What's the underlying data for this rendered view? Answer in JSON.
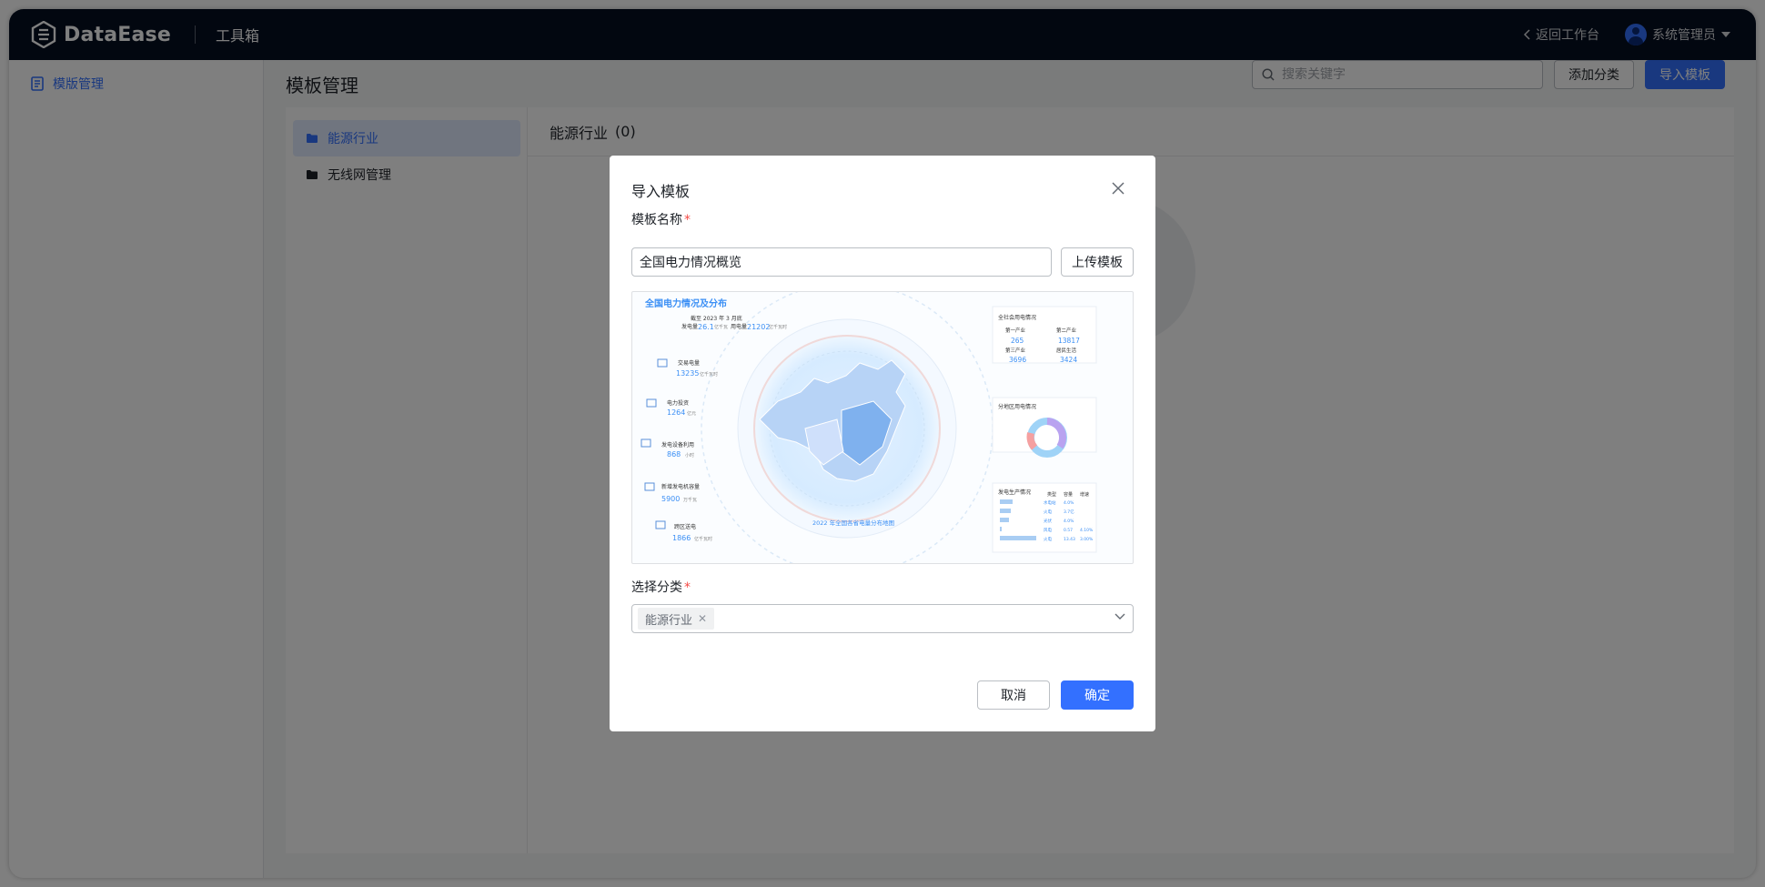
{
  "app": {
    "logo_text": "DataEase",
    "section": "工具箱"
  },
  "header": {
    "back_label": "返回工作台",
    "user_name": "系统管理员"
  },
  "sidebar": {
    "items": [
      {
        "label": "模版管理",
        "icon": "document-icon"
      }
    ]
  },
  "main": {
    "title": "模板管理",
    "search_placeholder": "搜索关键字",
    "add_category_label": "添加分类",
    "import_label": "导入模板",
    "categories": [
      {
        "label": "能源行业",
        "active": true
      },
      {
        "label": "无线网管理",
        "active": false
      }
    ],
    "current_category": "能源行业",
    "current_count": "(0)"
  },
  "modal": {
    "title": "导入模板",
    "name_label": "模板名称",
    "name_value": "全国电力情况概览",
    "upload_label": "上传模板",
    "category_label": "选择分类",
    "selected_category": "能源行业",
    "cancel_label": "取消",
    "confirm_label": "确定",
    "preview": {
      "title": "全国电力情况及分布",
      "deadline": "截至 2023 年 3 月底",
      "gen_label": "发电量",
      "gen_value": "26.1",
      "gen_unit": "亿千瓦",
      "use_label": "用电量",
      "use_value": "21202",
      "use_unit": "亿千瓦时",
      "metrics": [
        {
          "label": "交易电量",
          "value": "13235",
          "unit": "亿千瓦时"
        },
        {
          "label": "电力投资",
          "value": "1264",
          "unit": "亿元"
        },
        {
          "label": "发电设备利用",
          "value": "868",
          "unit": "小时"
        },
        {
          "label": "新增发电机容量",
          "value": "5900",
          "unit": "万千瓦"
        },
        {
          "label": "跨区送电",
          "value": "1866",
          "unit": "亿千瓦时"
        }
      ],
      "map_caption": "2022 年全国各省电量分布地图",
      "right_top_title": "全社会用电情况",
      "right_top_items": [
        {
          "label": "第一产业",
          "value": "265"
        },
        {
          "label": "第二产业",
          "value": "13817"
        },
        {
          "label": "第三产业",
          "value": "3696"
        },
        {
          "label": "居民生活",
          "value": "3424"
        }
      ],
      "right_mid_title": "分地区用电情况",
      "right_bot_title": "发电生产情况",
      "right_bot_headers": [
        "类型",
        "容量",
        "增速"
      ],
      "right_bot_rows": [
        {
          "name": "水电站",
          "cap": "4.0%",
          "rate": ""
        },
        {
          "name": "火电",
          "cap": "3.7亿",
          "rate": ""
        },
        {
          "name": "光伏",
          "cap": "4.0%",
          "rate": ""
        },
        {
          "name": "风电",
          "cap": "0.57",
          "rate": "4.10%"
        },
        {
          "name": "火电",
          "cap": "13.43",
          "rate": "3.00%"
        }
      ]
    }
  },
  "colors": {
    "primary": "#3370ff",
    "topbar": "#050e21",
    "danger": "#f54a45"
  }
}
